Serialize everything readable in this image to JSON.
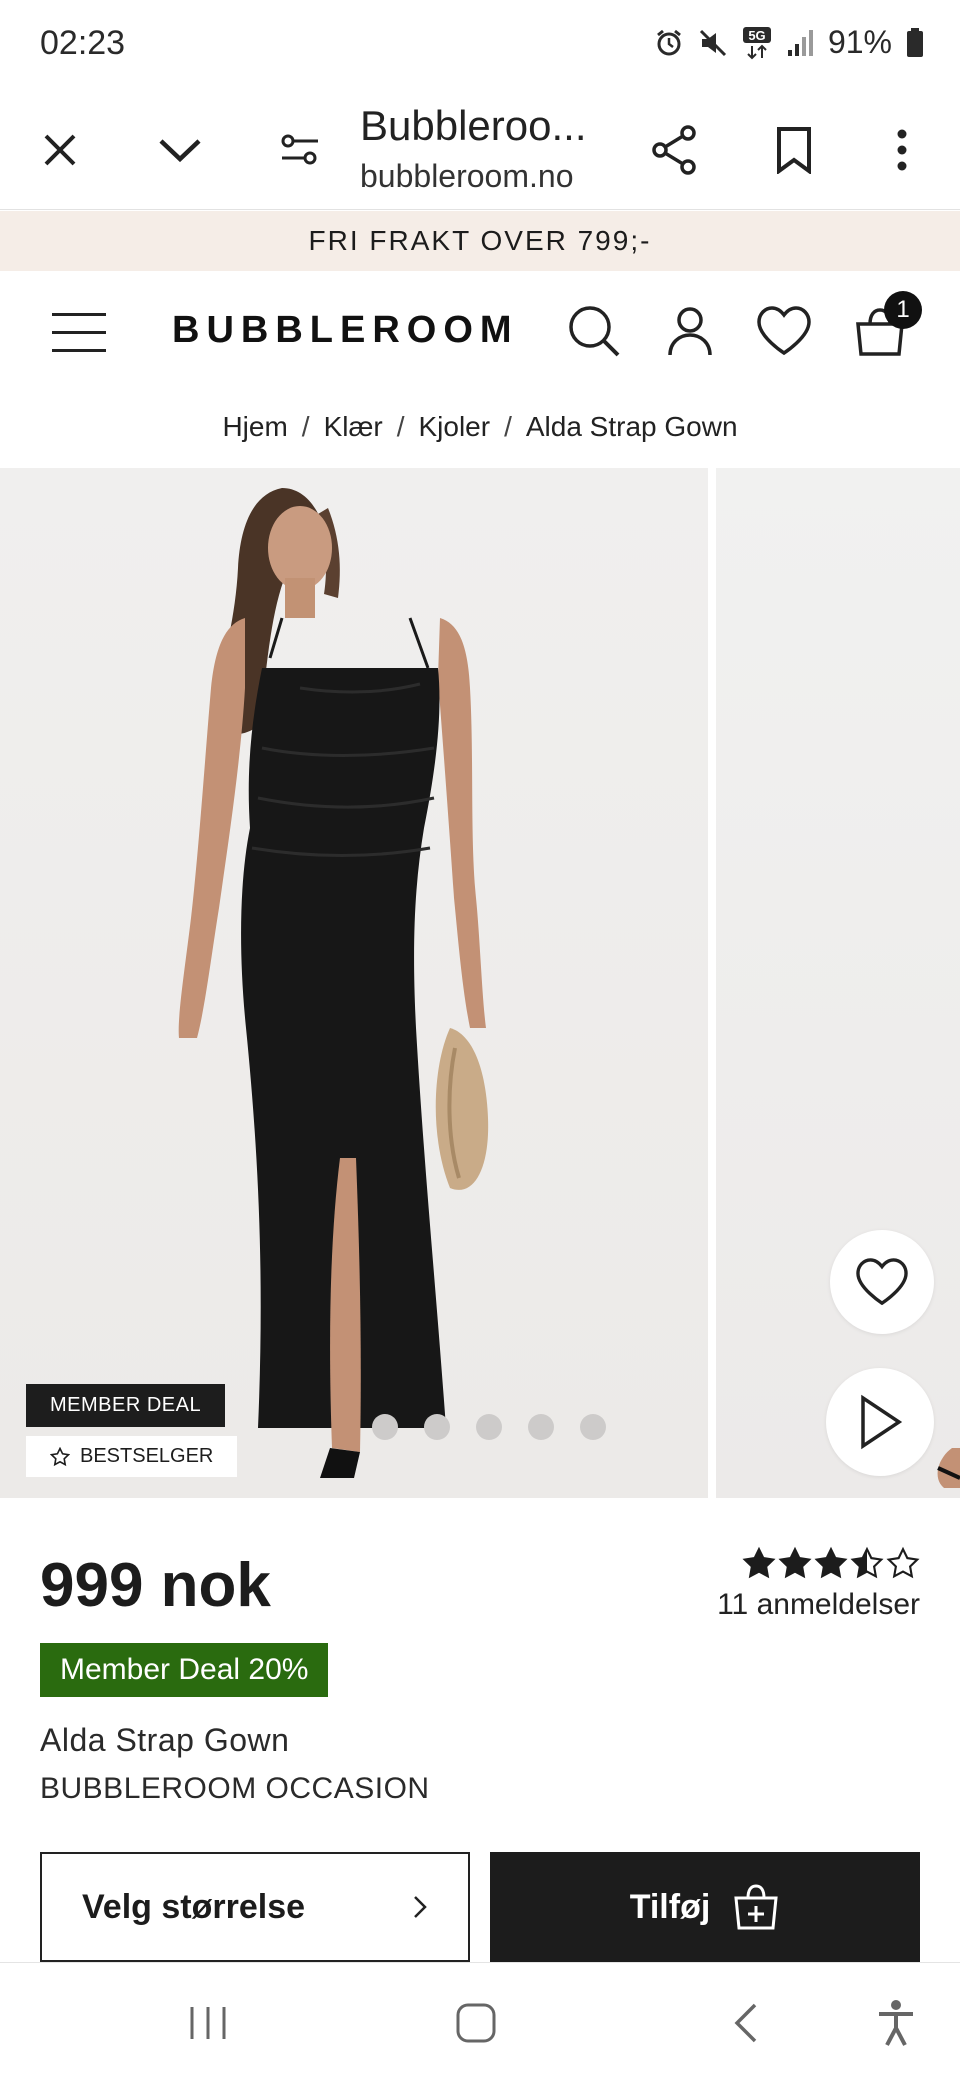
{
  "status_bar": {
    "time": "02:23",
    "battery": "91%",
    "icons": [
      "alarm-icon",
      "mute-icon",
      "5g-icon",
      "signal-icon",
      "battery-icon"
    ]
  },
  "browser": {
    "title": "Bubbleroo...",
    "url": "bubbleroom.no",
    "icons": [
      "close-icon",
      "chevron-down-icon",
      "page-settings-icon",
      "share-icon",
      "bookmark-icon",
      "more-icon"
    ]
  },
  "promo": {
    "text": "FRI FRAKT OVER 799;-"
  },
  "header": {
    "logo": "BUBBLEROOM",
    "cart_count": "1",
    "icons": [
      "menu-icon",
      "search-icon",
      "account-icon",
      "wishlist-icon",
      "cart-icon"
    ]
  },
  "breadcrumb": {
    "items": [
      "Hjem",
      "Klær",
      "Kjoler",
      "Alda Strap Gown"
    ],
    "separator": "/"
  },
  "gallery": {
    "badge_member": "MEMBER DEAL",
    "badge_bestseller": "BESTSELGER",
    "slide_count": 5,
    "active_slide": 0
  },
  "product": {
    "price": "999 nok",
    "rating": 3.5,
    "rating_max": 5,
    "reviews": "11 anmeldelser",
    "member_deal": "Member Deal 20%",
    "name": "Alda Strap Gown",
    "brand": "BUBBLEROOM OCCASION",
    "size_button": "Velg størrelse",
    "add_button": "Tilføj"
  },
  "colors": {
    "promo_bg": "#f5ede7",
    "member_deal_bg": "#2a6b0f",
    "dark": "#1c1c1c"
  }
}
